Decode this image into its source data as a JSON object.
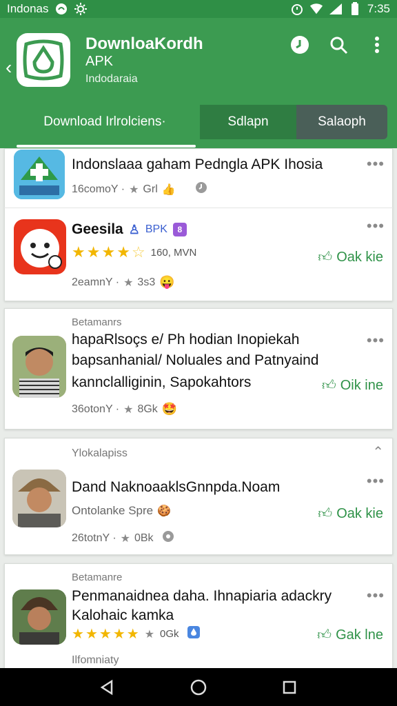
{
  "status_bar": {
    "carrier": "Indonas",
    "time": "7:35"
  },
  "app_bar": {
    "title": "DownloaKordh",
    "subtitle": "APK",
    "language": "Indodaraia"
  },
  "tabs": [
    {
      "label": "Download Irlrolciens·"
    },
    {
      "label": "Sdlapn"
    },
    {
      "label": "Salaoph"
    }
  ],
  "items": [
    {
      "title": "Indonslaaa gaham Pedngla APK Ihosia",
      "meta": "16comoY ·",
      "rating_text": "Grl"
    },
    {
      "title": "Geesila",
      "badge": "BPK",
      "rating_text": "160, MVN",
      "meta": "2eamnY ·",
      "rating": "3s3",
      "action": "Oak kie"
    },
    {
      "section": "Betamanrs",
      "title_lines": [
        "hapaRlsoçs e/ Ph hodian Inopiekah",
        "bapsanhanial/ Noluales and Patnyaind",
        "kannclalliginin, Sapokahtors"
      ],
      "meta": "36otonY ·",
      "rating": "8Gk",
      "action": "Oik ine"
    },
    {
      "section": "Ylokalapiss",
      "title": "Dand NaknoaaklsGnnpda.Noam",
      "subtitle": "Ontolanke Spre",
      "meta": "26totnY ·",
      "rating": "0Bk",
      "action": "Oak kie"
    },
    {
      "section": "Betamanre",
      "title_lines": [
        "Penmanaidnea daha. Ihnapiaria adackry",
        "Kalohaic kamka"
      ],
      "rating": "0Gk",
      "footer": "Ilfomniaty",
      "action": "Gak lne"
    }
  ]
}
